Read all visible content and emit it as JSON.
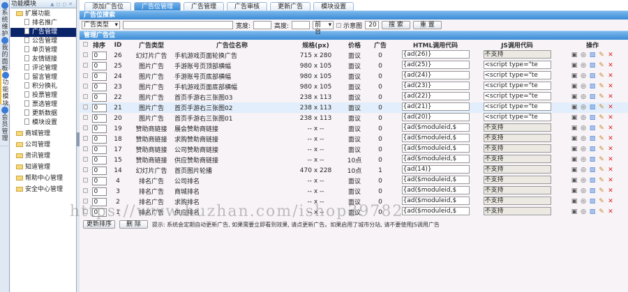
{
  "left_tabs": [
    {
      "label": "系统维护"
    },
    {
      "label": "我的面板"
    },
    {
      "label": "功能模块",
      "active": true
    },
    {
      "label": "会员管理"
    }
  ],
  "sidebar": {
    "title": "功能模块",
    "groups": [
      {
        "label": "扩展功能",
        "items": [
          "排名推广",
          "广告管理",
          "公告管理",
          "单页管理",
          "友情链接",
          "评论管理",
          "留言管理",
          "积分换礼",
          "投票管理",
          "票选管理",
          "更新数据",
          "模块设置"
        ]
      },
      {
        "label": "商城管理"
      },
      {
        "label": "公司管理"
      },
      {
        "label": "资讯管理"
      },
      {
        "label": "知道管理"
      },
      {
        "label": "帮助中心管理"
      },
      {
        "label": "安全中心管理"
      }
    ],
    "selected": "广告管理"
  },
  "tabs": [
    "添加广告位",
    "广告位管理",
    "广告管理",
    "广告审核",
    "更新广告",
    "模块设置"
  ],
  "active_tab": "广告位管理",
  "search": {
    "title": "广告位搜索",
    "type_select": "广告类型",
    "keyword": "",
    "width_label": "宽度:",
    "height_label": "高度:",
    "scope_select": "前台",
    "preview_label": "示意图",
    "page_size": "20",
    "search_btn": "搜 索",
    "reset_btn": "重 置"
  },
  "list": {
    "title": "管理广告位",
    "columns": [
      "排序",
      "ID",
      "广告类型",
      "广告位名称",
      "规格(px)",
      "价格",
      "广告",
      "HTML调用代码",
      "JS调用代码",
      "操作"
    ],
    "rows": [
      [
        "0",
        "26",
        "幻灯片广告",
        "手机游戏页面轮换广告",
        "715 x 280",
        "面议",
        "0",
        "{ad(26)}",
        "不支持"
      ],
      [
        "0",
        "25",
        "图片广告",
        "手游账号页顶部横幅",
        "980 x 105",
        "面议",
        "0",
        "{ad(25)}",
        "<script type=\"te"
      ],
      [
        "0",
        "24",
        "图片广告",
        "手游账号页底部横幅",
        "980 x 105",
        "面议",
        "0",
        "{ad(24)}",
        "<script type=\"te"
      ],
      [
        "0",
        "23",
        "图片广告",
        "手机游戏页面底部横幅",
        "980 x 105",
        "面议",
        "0",
        "{ad(23)}",
        "<script type=\"te"
      ],
      [
        "0",
        "22",
        "图片广告",
        "首页手游右三张图03",
        "238 x 113",
        "面议",
        "0",
        "{ad(22)}",
        "<script type=\"te"
      ],
      [
        "0",
        "21",
        "图片广告",
        "首页手游右三张图02",
        "238 x 113",
        "面议",
        "0",
        "{ad(21)}",
        "<script type=\"te"
      ],
      [
        "0",
        "20",
        "图片广告",
        "首页手游右三张图01",
        "238 x 113",
        "面议",
        "0",
        "{ad(20)}",
        "<script type=\"te"
      ],
      [
        "0",
        "19",
        "赞助商链接",
        "展会赞助商链接",
        "-- x --",
        "面议",
        "0",
        "{ad($moduleid,$",
        "不支持"
      ],
      [
        "0",
        "18",
        "赞助商链接",
        "求购赞助商链接",
        "-- x --",
        "面议",
        "0",
        "{ad($moduleid,$",
        "不支持"
      ],
      [
        "0",
        "17",
        "赞助商链接",
        "公司赞助商链接",
        "-- x --",
        "面议",
        "0",
        "{ad($moduleid,$",
        "不支持"
      ],
      [
        "0",
        "15",
        "赞助商链接",
        "供应赞助商链接",
        "-- x --",
        "10点",
        "0",
        "{ad($moduleid,$",
        "不支持"
      ],
      [
        "0",
        "14",
        "幻灯片广告",
        "首页图片轮播",
        "470 x 228",
        "10点",
        "1",
        "{ad(14)}",
        "不支持"
      ],
      [
        "0",
        "4",
        "排名广告",
        "公司排名",
        "-- x --",
        "面议",
        "0",
        "{ad($moduleid,$",
        "不支持"
      ],
      [
        "0",
        "3",
        "排名广告",
        "商城排名",
        "-- x --",
        "面议",
        "0",
        "{ad($moduleid,$",
        "不支持"
      ],
      [
        "0",
        "2",
        "排名广告",
        "求购排名",
        "-- x --",
        "面议",
        "0",
        "{ad($moduleid,$",
        "不支持"
      ],
      [
        "0",
        "1",
        "排名广告",
        "供应排名",
        "-- x --",
        "面议",
        "0",
        "{ad($moduleid,$",
        "不支持"
      ]
    ],
    "highlight_id": "21",
    "ops": [
      "view-icon",
      "stats-icon",
      "preview-icon",
      "edit-icon",
      "delete-icon"
    ]
  },
  "footer": {
    "update_order_btn": "更新排序",
    "delete_btn": "删 除",
    "tip": "提示: 系统会定期自动更新广告, 如果需要立即看到效果, 请点更新广告。如果启用了城市分站, 请不要使用JS调用广告"
  },
  "watermark": "https://www.huzhan.com/ishop39782"
}
